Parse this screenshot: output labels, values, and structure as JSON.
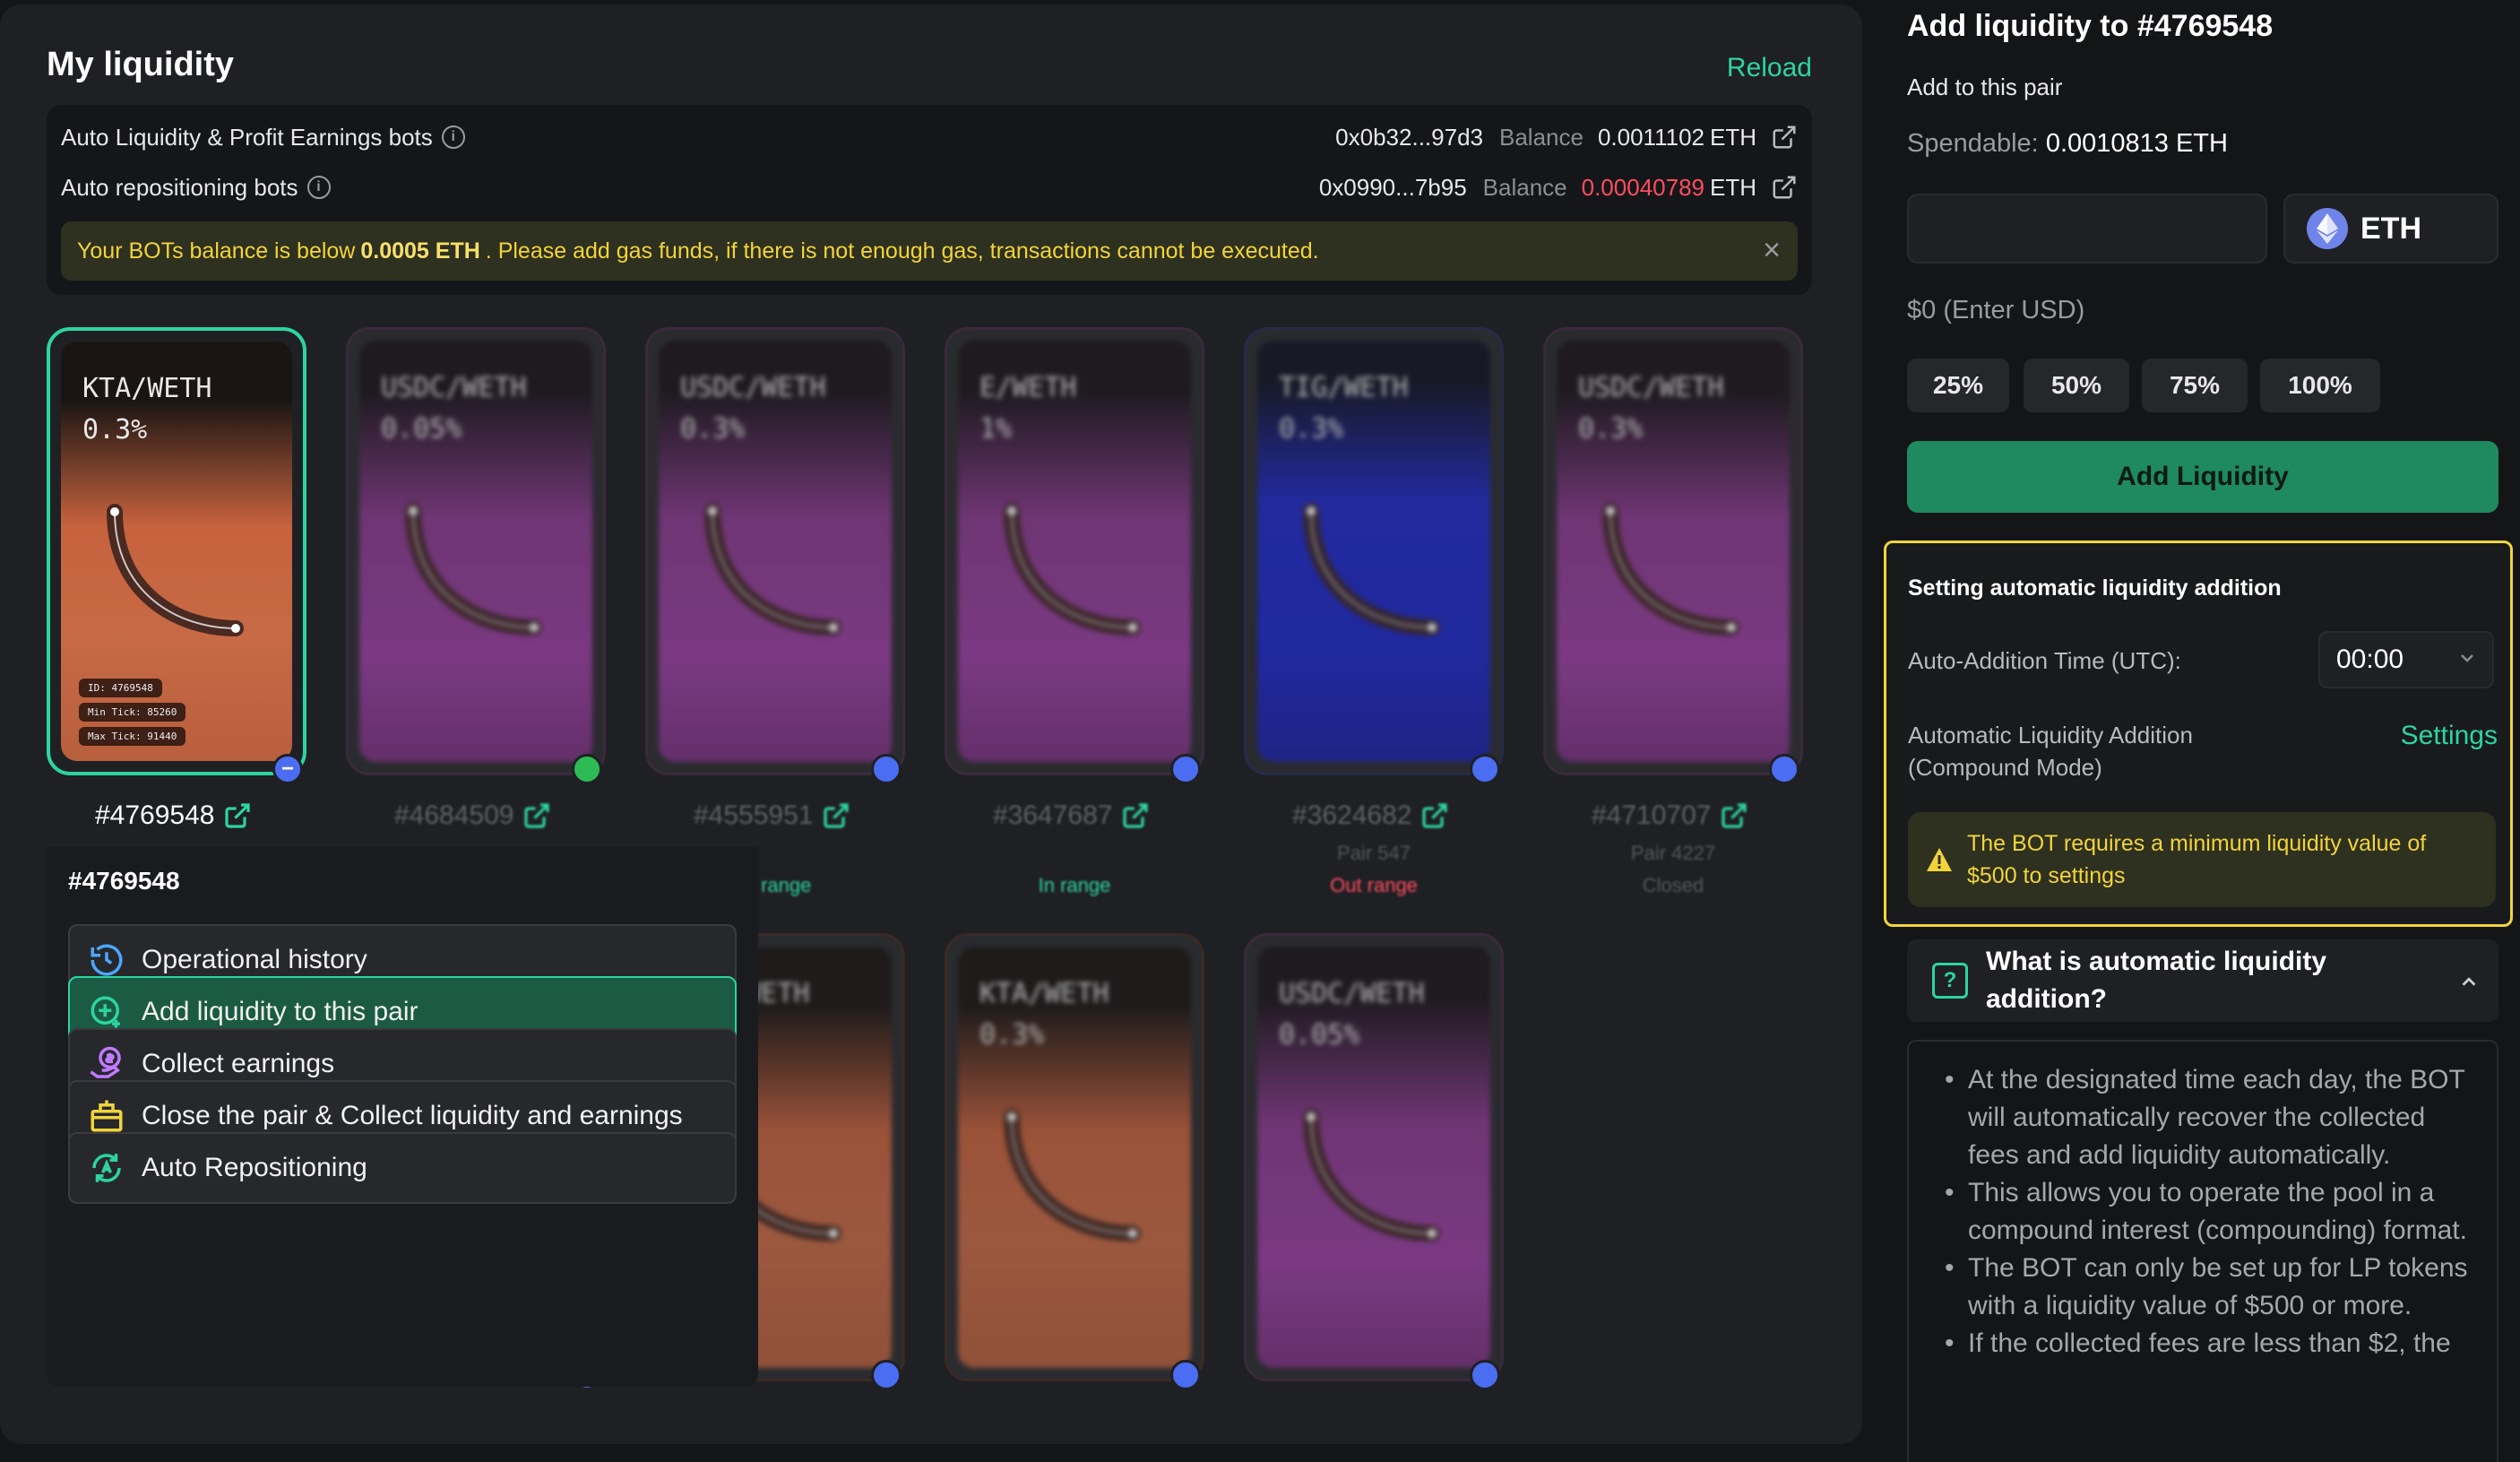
{
  "my_liquidity": {
    "title": "My liquidity",
    "reload_label": "Reload",
    "bots": [
      {
        "label": "Auto Liquidity & Profit Earnings bots",
        "address": "0x0b32...97d3",
        "balance_label": "Balance",
        "balance": "0.0011102",
        "unit": "ETH",
        "balance_color": "#ffffff"
      },
      {
        "label": "Auto repositioning bots",
        "address": "0x0990...7b95",
        "balance_label": "Balance",
        "balance": "0.00040789",
        "unit": "ETH",
        "balance_color": "#ff4d5e"
      }
    ],
    "warning": {
      "prefix": "Your BOTs balance is below",
      "threshold": "0.0005 ETH",
      "suffix": ". Please add gas funds, if there is not enough gas, transactions cannot be executed."
    }
  },
  "cards": [
    {
      "pair": "KTA/WETH",
      "fee": "0.3%",
      "id": "#4769548",
      "token_id_tag": "ID: 4769548",
      "min_tick": "Min Tick: 85260",
      "max_tick": "Max Tick: 91440",
      "selected": true,
      "theme": "orange"
    },
    {
      "pair": "USDC/WETH",
      "fee": "0.05%",
      "id": "#4684509",
      "theme": "purple"
    },
    {
      "pair": "USDC/WETH",
      "fee": "0.3%",
      "id": "#4555951",
      "status": "In range",
      "theme": "purple"
    },
    {
      "pair": "E/WETH",
      "fee": "1%",
      "id": "#3647687",
      "status": "In range",
      "theme": "purple"
    },
    {
      "pair": "TIG/WETH",
      "fee": "0.3%",
      "id": "#3624682",
      "sub": "Pair 547",
      "status": "Out range",
      "theme": "blue"
    },
    {
      "pair": "USDC/WETH",
      "fee": "0.3%",
      "id": "#4710707",
      "sub": "Pair 4227",
      "status": "Closed",
      "theme": "purple"
    },
    {
      "pair": "WETH",
      "fee": "",
      "theme": "orange"
    },
    {
      "pair": "KTA/WETH",
      "fee": "0.3%",
      "theme": "orange"
    },
    {
      "pair": "KTA/WETH",
      "fee": "0.3%",
      "theme": "orange"
    },
    {
      "pair": "USDC/WETH",
      "fee": "0.05%",
      "theme": "purple"
    }
  ],
  "popup": {
    "title": "#4769548",
    "items": [
      {
        "label": "Operational history",
        "icon": "history-icon"
      },
      {
        "label": "Add liquidity to this pair",
        "icon": "add-liquidity-icon",
        "active": true
      },
      {
        "label": "Collect earnings",
        "icon": "collect-earnings-icon"
      },
      {
        "label": "Close the pair & Collect liquidity and earnings",
        "icon": "close-pair-icon"
      },
      {
        "label": "Auto Repositioning",
        "icon": "auto-reposition-icon"
      }
    ]
  },
  "add_panel": {
    "title": "Add liquidity to #4769548",
    "subtitle": "Add to this pair",
    "spendable_label": "Spendable:",
    "spendable_value": "0.0010813 ETH",
    "amount_value": "",
    "token": "ETH",
    "usd_text": "$0 (Enter USD)",
    "percents": [
      "25%",
      "50%",
      "75%",
      "100%"
    ],
    "add_button": "Add Liquidity",
    "accent": "#2dd4a0"
  },
  "auto_setting": {
    "title": "Setting automatic liquidity addition",
    "time_label": "Auto-Addition Time (UTC):",
    "time_value": "00:00",
    "compound_label": "Automatic Liquidity Addition (Compound Mode)",
    "settings_link": "Settings",
    "min_warning": "The BOT requires a minimum liquidity value of $500 to settings"
  },
  "faq": {
    "question": "What is automatic liquidity addition?",
    "answers": [
      "At the designated time each day, the BOT will automatically recover the collected fees and add liquidity automatically.",
      "This allows you to operate the pool in a compound interest (compounding) format.",
      "The BOT can only be set up for LP tokens with a liquidity value of $500 or more.",
      "If the collected fees are less than $2, the"
    ]
  }
}
